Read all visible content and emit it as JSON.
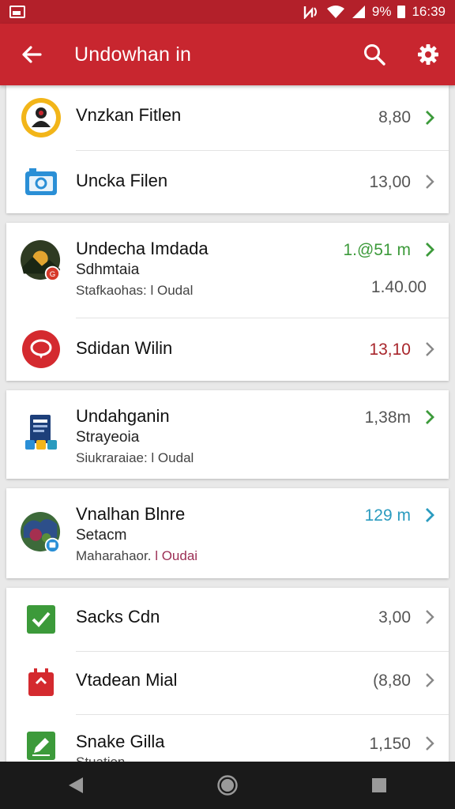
{
  "status_bar": {
    "battery_text": "9%",
    "time": "16:39"
  },
  "app_bar": {
    "title": "Undowhan in"
  },
  "colors": {
    "primary": "#c8262f",
    "status_bar": "#b3202a",
    "green": "#3c9a3a",
    "red": "#c0262f",
    "teal": "#2a9bbf"
  },
  "items": [
    {
      "icon": "avatar-badge-icon",
      "title": "Vnzkan Fitlen",
      "value": "8,80"
    },
    {
      "icon": "camera-icon",
      "title": "Uncka Filen",
      "value": "13,00"
    },
    {
      "icon": "avatar-photo-icon",
      "title": "Undecha Imdada",
      "subtitle": "Sdhmtaia",
      "detail": "Stafkaohas: l Oudal",
      "value": "1.@51 m",
      "value2": "1.40.00"
    },
    {
      "icon": "chat-bubble-icon",
      "title": "Sdidan Wilin",
      "value": "13,10"
    },
    {
      "icon": "document-icon",
      "title": "Undahganin",
      "subtitle": "Strayeoia",
      "detail": "Siukraraiae: l Oudal",
      "value": "1,38m"
    },
    {
      "icon": "avatar-photo-icon",
      "title": "Vnalhan Blnre",
      "subtitle": "Setacm",
      "detail_prefix": "Maharahaor.",
      "detail_suffix": "l Oudai",
      "value": "129 m"
    },
    {
      "icon": "checkbox-icon",
      "title": "Sacks Cdn",
      "value": "3,00"
    },
    {
      "icon": "calendar-icon",
      "title": "Vtadean Mial",
      "value": "(8,80"
    },
    {
      "icon": "edit-icon",
      "title": "Snake Gilla",
      "subtitle": "Stuation",
      "value": "1,150"
    }
  ]
}
